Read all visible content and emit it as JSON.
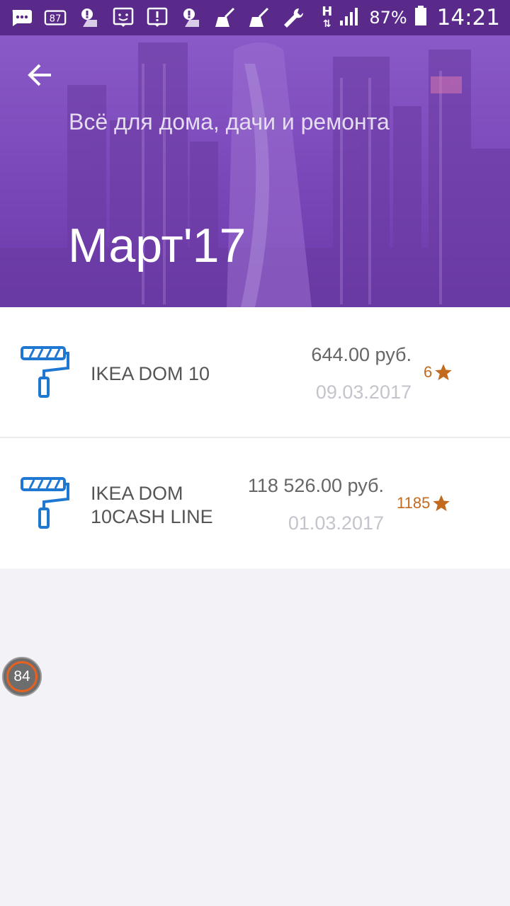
{
  "status_bar": {
    "icons": [
      "message-icon",
      "notification-87-icon",
      "alert-person-icon",
      "face-icon",
      "alert-box-icon",
      "alert-person-icon",
      "broom-icon",
      "broom-icon",
      "wrench-icon"
    ],
    "badge_text": "87",
    "network": "H",
    "battery": "87%",
    "time": "14:21"
  },
  "header": {
    "subtitle": "Всё для дома, дачи и ремонта",
    "title": "Март'17"
  },
  "transactions": [
    {
      "name": "IKEA DOM 10",
      "amount": "644.00 руб.",
      "date": "09.03.2017",
      "points": "6",
      "icon": "paint-roller-icon"
    },
    {
      "name_line1": "IKEA DOM",
      "name_line2": "10CASH LINE",
      "amount": "118 526.00 руб.",
      "date": "01.03.2017",
      "points": "1185",
      "icon": "paint-roller-icon"
    }
  ],
  "floating_badge": {
    "value": "84"
  },
  "colors": {
    "status_bar": "#5a2a8a",
    "header": "#7a47b8",
    "roller_icon": "#1e78d2",
    "points": "#c26a1d"
  }
}
